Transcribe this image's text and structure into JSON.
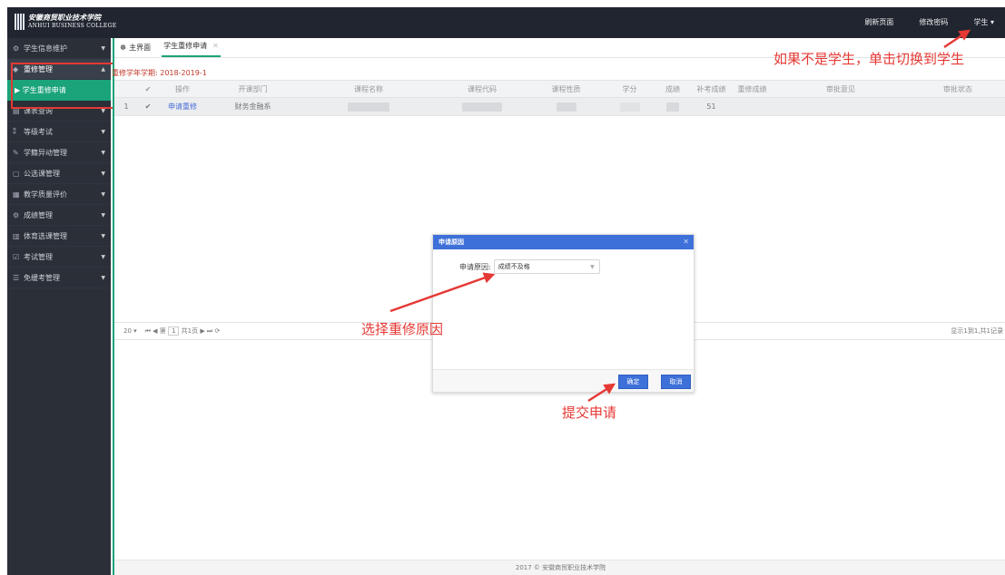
{
  "header": {
    "logo_cn": "安徽商贸职业技术学院",
    "logo_en": "ANHUI BUSINESS COLLEGE",
    "links": [
      "刷新页面",
      "修改密码",
      "学生 ▾"
    ]
  },
  "sidebar": {
    "items": [
      {
        "label": "学生信息维护",
        "icon": "gear-icon",
        "glyph": "⚙"
      },
      {
        "label": "重修管理",
        "icon": "graduation-cap-icon",
        "glyph": "◆"
      },
      {
        "label": "课表查询",
        "icon": "calendar-icon",
        "glyph": "▤"
      },
      {
        "label": "等级考试",
        "icon": "chart-icon",
        "glyph": "⁑"
      },
      {
        "label": "学籍异动管理",
        "icon": "pencil-icon",
        "glyph": "✎"
      },
      {
        "label": "公选课管理",
        "icon": "document-icon",
        "glyph": "▢"
      },
      {
        "label": "教学质量评价",
        "icon": "table-icon",
        "glyph": "▦"
      },
      {
        "label": "成绩管理",
        "icon": "settings-icon",
        "glyph": "⚙"
      },
      {
        "label": "体育选课管理",
        "icon": "list-icon",
        "glyph": "▥"
      },
      {
        "label": "考试管理",
        "icon": "checkbox-icon",
        "glyph": "☑"
      },
      {
        "label": "免缓考管理",
        "icon": "menu-icon",
        "glyph": "☰"
      }
    ],
    "sub_item": "学生重修申请"
  },
  "tabs": [
    "主界面",
    "学生重修申请"
  ],
  "term_label": "重修学年学期: 2018-2019-1",
  "table": {
    "headers": [
      "",
      "✔",
      "操作",
      "开课部门",
      "课程名称",
      "课程代码",
      "课程性质",
      "学分",
      "成绩",
      "补考成绩",
      "重修成绩",
      "审批意见",
      "审批状态"
    ],
    "rows": [
      {
        "index": "1",
        "check": "✔",
        "action": "申请重修",
        "dept": "财务金融系",
        "makeup": "51"
      }
    ]
  },
  "pager": {
    "size": "20 ▾",
    "controls": "⏮ ◀ 第",
    "page": "1",
    "total": "共1页 ▶ ⏭ ⟳",
    "summary": "显示1到1,共1记录"
  },
  "footer": "2017 © 安徽商贸职业技术学院",
  "dialog": {
    "title": "申请原因",
    "field_label": "申请原因:",
    "field_value": "成绩不及格",
    "ok": "确定",
    "cancel": "取消"
  },
  "annotations": {
    "top": "如果不是学生，单击切换到学生",
    "middle": "选择重修原因",
    "bottom": "提交申请"
  },
  "colors": {
    "accent": "#1ba37a",
    "dialog_blue": "#3e70d9",
    "annotation_red": "#e53935",
    "sidebar": "#2a2f38"
  }
}
